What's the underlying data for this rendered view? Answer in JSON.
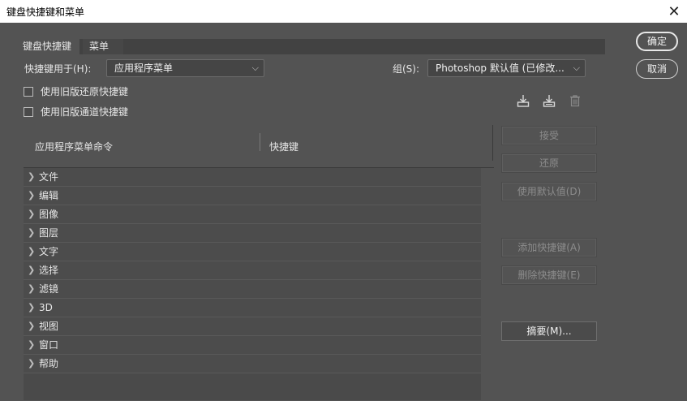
{
  "window": {
    "title": "键盘快捷键和菜单"
  },
  "tabs": [
    {
      "label": "键盘快捷键"
    },
    {
      "label": "菜单"
    }
  ],
  "shortcuts_for": {
    "label": "快捷键用于(H):",
    "value": "应用程序菜单"
  },
  "group": {
    "label": "组(S):",
    "value": "Photoshop 默认值 (已修改..."
  },
  "checkboxes": [
    {
      "label": "使用旧版还原快捷键"
    },
    {
      "label": "使用旧版通道快捷键"
    }
  ],
  "table": {
    "columns": [
      "应用程序菜单命令",
      "快捷键"
    ],
    "rows": [
      {
        "label": "文件"
      },
      {
        "label": "编辑"
      },
      {
        "label": "图像"
      },
      {
        "label": "图层"
      },
      {
        "label": "文字"
      },
      {
        "label": "选择"
      },
      {
        "label": "滤镜"
      },
      {
        "label": "3D"
      },
      {
        "label": "视图"
      },
      {
        "label": "窗口"
      },
      {
        "label": "帮助"
      }
    ]
  },
  "side_buttons": {
    "accept": "接受",
    "restore": "还原",
    "use_default": "使用默认值(D)",
    "add_shortcut": "添加快捷键(A)",
    "delete_shortcut": "删除快捷键(E)",
    "summarize": "摘要(M)..."
  },
  "dialog_buttons": {
    "ok": "确定",
    "cancel": "取消"
  }
}
